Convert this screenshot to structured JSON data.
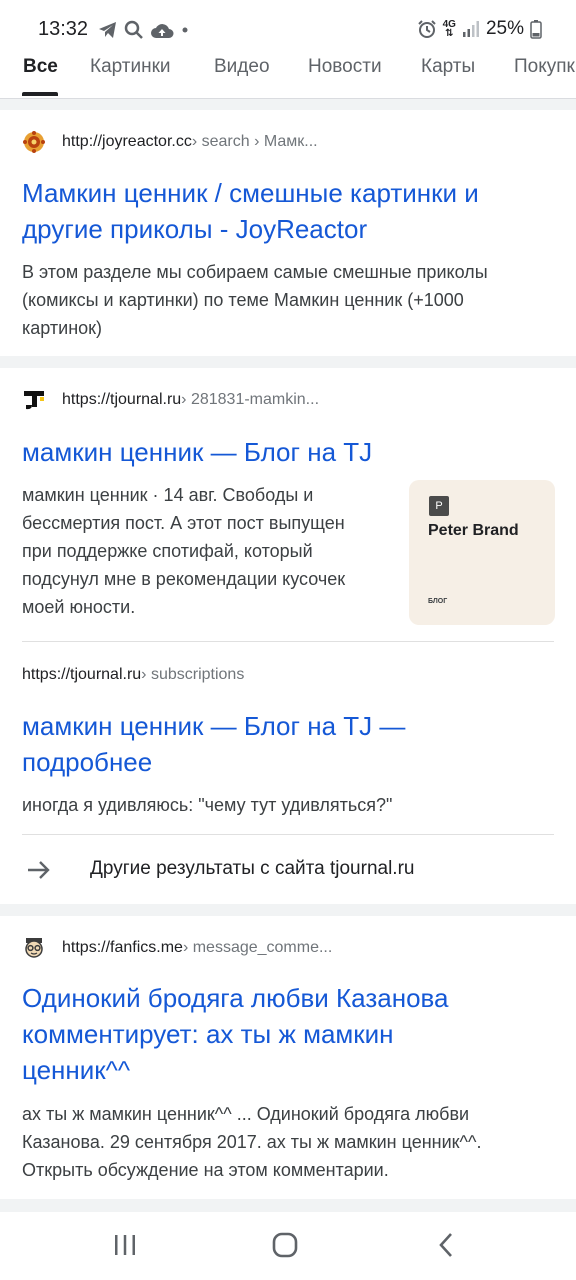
{
  "status_bar": {
    "time": "13:32",
    "network_label": "4G",
    "network_sublabel": "⇅",
    "battery": "25%"
  },
  "tabs": [
    {
      "label": "Все",
      "active": true
    },
    {
      "label": "Картинки",
      "active": false
    },
    {
      "label": "Видео",
      "active": false
    },
    {
      "label": "Новости",
      "active": false
    },
    {
      "label": "Карты",
      "active": false
    },
    {
      "label": "Покупки",
      "active": false
    }
  ],
  "results": [
    {
      "url": "http://joyreactor.cc",
      "path": " › search › Мамк...",
      "title_line1": "Мамкин ценник / смешные картинки и",
      "title_line2": "другие приколы - JoyReactor",
      "snippet_lines": [
        "В этом разделе мы собираем самые смешные приколы",
        "(комиксы и картинки) по теме Мамкин ценник (+1000",
        "картинок)"
      ]
    },
    {
      "url": "https://tjournal.ru",
      "path": " › 281831-mamkin...",
      "title": "мамкин ценник — Блог на TJ",
      "snippet_lines": [
        "мамкин ценник · 14 авг. Свободы и",
        "бессмертия пост. А этот пост выпущен",
        "при поддержке спотифай, который",
        "подсунул мне в рекомендации кусочек",
        "моей юности."
      ],
      "thumbnail": {
        "badge": "P",
        "title": "Peter Brand",
        "caption": "БЛОГ"
      },
      "sub_url": "https://tjournal.ru",
      "sub_path": " › subscriptions",
      "sub_title_line1": "мамкин ценник — Блог на TJ —",
      "sub_title_line2": "подробнее",
      "sub_snippet": "иногда я удивляюсь: \"чему тут удивляться?\"",
      "more_results": "Другие результаты с сайта tjournal.ru"
    },
    {
      "url": "https://fanfics.me",
      "path": " › message_comme...",
      "title_lines": [
        "Одинокий бродяга любви Казанова",
        "комментирует: ах ты ж мамкин",
        "ценник^^"
      ],
      "snippet_lines": [
        "ах ты ж мамкин ценник^^ ... Одинокий бродяга любви",
        "Казанова. 29 сентября 2017. ах ты ж мамкин ценник^^.",
        "Открыть обсуждение на этом комментарии."
      ]
    }
  ],
  "colors": {
    "link": "#1558d6",
    "text": "#202124",
    "secondary": "#70757a",
    "background": "#f1f3f4"
  },
  "icons": {
    "favicon1": "joyreactor-favicon-icon",
    "favicon2": "tjournal-favicon-icon",
    "favicon3": "fanfics-favicon-icon",
    "more": "arrow-right-icon",
    "nav_recent": "recent-apps-icon",
    "nav_home": "home-icon",
    "nav_back": "back-icon"
  }
}
